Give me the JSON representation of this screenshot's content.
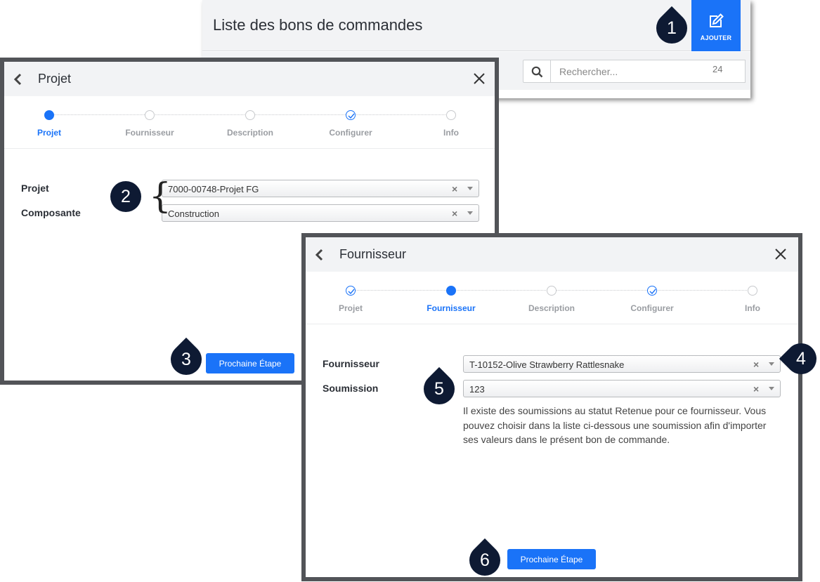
{
  "list_window": {
    "title": "Liste des bons de commandes",
    "add_button_label": "AJOUTER",
    "search_placeholder": "Rechercher...",
    "result_count": "24",
    "colors": {
      "accent": "#1a73f8",
      "header_bg": "#f2f3f5"
    }
  },
  "dialog_projet": {
    "title": "Projet",
    "steps": [
      {
        "label": "Projet",
        "state": "active"
      },
      {
        "label": "Fournisseur",
        "state": "pending"
      },
      {
        "label": "Description",
        "state": "pending"
      },
      {
        "label": "Configurer",
        "state": "done"
      },
      {
        "label": "Info",
        "state": "pending"
      }
    ],
    "fields": {
      "projet_label": "Projet",
      "projet_value": "7000-00748-Projet FG",
      "composante_label": "Composante",
      "composante_value": "Construction"
    },
    "next_button_label": "Prochaine Étape"
  },
  "dialog_fournisseur": {
    "title": "Fournisseur",
    "steps": [
      {
        "label": "Projet",
        "state": "done"
      },
      {
        "label": "Fournisseur",
        "state": "active"
      },
      {
        "label": "Description",
        "state": "pending"
      },
      {
        "label": "Configurer",
        "state": "done"
      },
      {
        "label": "Info",
        "state": "pending"
      }
    ],
    "fields": {
      "fournisseur_label": "Fournisseur",
      "fournisseur_value": "T-10152-Olive Strawberry Rattlesnake",
      "soumission_label": "Soumission",
      "soumission_value": "123"
    },
    "info_text": "Il existe des soumissions au statut Retenue pour ce fournisseur. Vous pouvez choisir dans la liste ci-dessous une soumission afin d'importer ses valeurs dans le présent bon de commande.",
    "next_button_label": "Prochaine Étape"
  },
  "callouts": [
    "1",
    "2",
    "3",
    "4",
    "5",
    "6"
  ],
  "icons": [
    "edit-icon",
    "search-icon",
    "back-icon",
    "close-icon",
    "check-icon",
    "clear-icon",
    "caret-icon"
  ]
}
